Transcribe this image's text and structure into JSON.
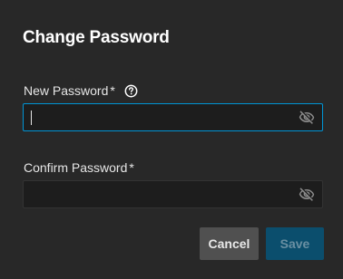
{
  "dialog": {
    "title": "Change Password"
  },
  "new_password": {
    "label": "New Password",
    "required_marker": "*",
    "value": "",
    "help_icon": "help-circle-icon",
    "visibility_icon": "eye-off-icon"
  },
  "confirm_password": {
    "label": "Confirm Password",
    "required_marker": "*",
    "value": "",
    "visibility_icon": "eye-off-icon"
  },
  "actions": {
    "cancel_label": "Cancel",
    "save_label": "Save"
  },
  "colors": {
    "dialog_bg": "#282828",
    "input_bg": "#1d1d1d",
    "focus_border": "#0095d5",
    "cancel_bg": "#505050",
    "save_bg_disabled": "#0b4e6d"
  }
}
